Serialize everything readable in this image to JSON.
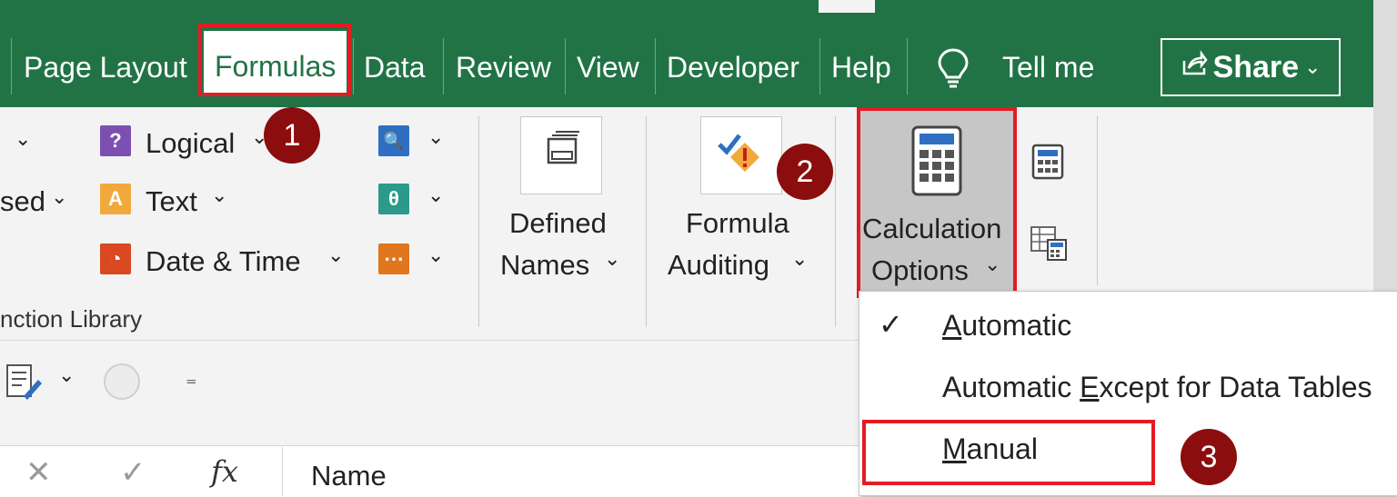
{
  "tabs": [
    {
      "label": "Page Layout"
    },
    {
      "label": "Formulas"
    },
    {
      "label": "Data"
    },
    {
      "label": "Review"
    },
    {
      "label": "View"
    },
    {
      "label": "Developer"
    },
    {
      "label": "Help"
    }
  ],
  "tell_me": "Tell me",
  "share": "Share",
  "function_library": {
    "logical": "Logical",
    "text": "Text",
    "date_time": "Date & Time",
    "partial_left_label": "sed",
    "group_label": "nction Library"
  },
  "defined_names": {
    "line1": "Defined",
    "line2": "Names"
  },
  "formula_auditing": {
    "line1": "Formula",
    "line2": "Auditing"
  },
  "calculation_options": {
    "line1": "Calculation",
    "line2": "Options"
  },
  "dropdown": {
    "items": [
      {
        "label": "Automatic",
        "checked": true,
        "accelerator": "A"
      },
      {
        "label": "Automatic Except for Data Tables",
        "checked": false,
        "accelerator": "E"
      },
      {
        "label": "Manual",
        "checked": false,
        "accelerator": "M"
      }
    ]
  },
  "formula_bar": {
    "value": "Name",
    "fx": "fx"
  },
  "badges": [
    "1",
    "2",
    "3"
  ],
  "colors": {
    "excel_green": "#217346",
    "highlight_red": "#e31b23",
    "badge": "#8b0d0d"
  }
}
